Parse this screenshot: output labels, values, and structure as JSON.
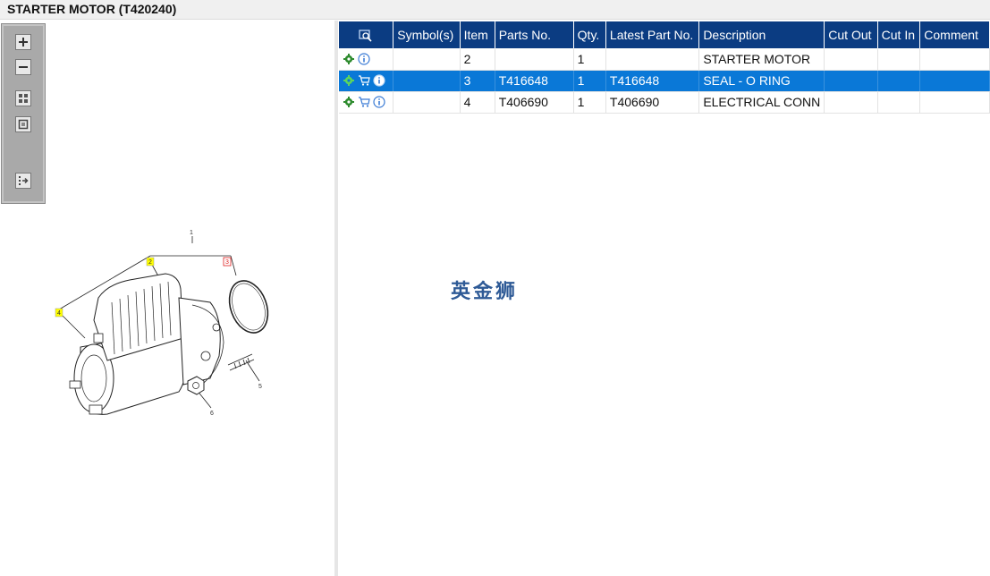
{
  "window": {
    "title": "STARTER MOTOR (T420240)"
  },
  "toolbar": {
    "buttons": [
      {
        "icon": "zoom-in-icon"
      },
      {
        "icon": "zoom-out-icon"
      },
      {
        "icon": "fit-all-icon"
      },
      {
        "icon": "fit-window-icon"
      },
      {
        "icon": "export-icon"
      }
    ]
  },
  "diagram": {
    "callouts": [
      "1",
      "2",
      "3",
      "4",
      "5",
      "6"
    ]
  },
  "table": {
    "headers": [
      "",
      "Symbol(s)",
      "Item",
      "Parts No.",
      "Qty.",
      "Latest Part No.",
      "Description",
      "Cut Out",
      "Cut In",
      "Comment"
    ],
    "rows": [
      {
        "icons": [
          "gear-icon",
          "info-icon"
        ],
        "symbols": "",
        "item": "2",
        "parts_no": "",
        "qty": "1",
        "latest": "",
        "description": "STARTER MOTOR",
        "cut_out": "",
        "cut_in": "",
        "comment": ""
      },
      {
        "icons": [
          "gear-icon",
          "cart-icon",
          "info-icon"
        ],
        "symbols": "",
        "item": "3",
        "parts_no": "T416648",
        "qty": "1",
        "latest": "T416648",
        "description": "SEAL - O RING",
        "cut_out": "",
        "cut_in": "",
        "comment": ""
      },
      {
        "icons": [
          "gear-icon",
          "cart-icon",
          "info-icon"
        ],
        "symbols": "",
        "item": "4",
        "parts_no": "T406690",
        "qty": "1",
        "latest": "T406690",
        "description": "ELECTRICAL CONN",
        "cut_out": "",
        "cut_in": "",
        "comment": ""
      }
    ],
    "selected_row": 1
  },
  "watermark": "英金狮",
  "colors": {
    "header_bg": "#0b3c82",
    "selected_bg": "#0a78d7",
    "callout_yellow": "#ffff00",
    "callout_red": "#e02020"
  }
}
